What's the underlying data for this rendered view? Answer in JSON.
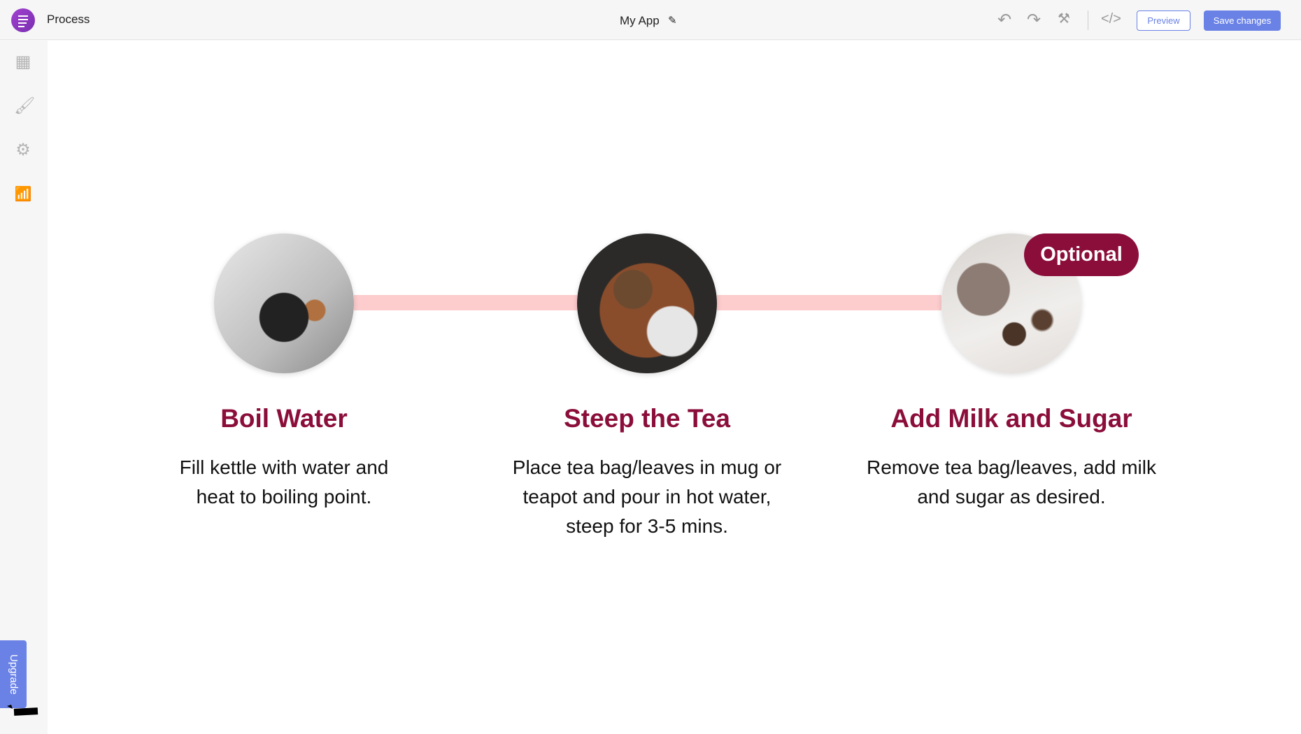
{
  "header": {
    "app_name": "Process",
    "title": "My App",
    "preview_label": "Preview",
    "save_label": "Save changes"
  },
  "sidebar": {
    "items": [
      "table-icon",
      "brush-icon",
      "gear-icon",
      "analytics-icon"
    ],
    "upgrade_label": "Upgrade"
  },
  "colors": {
    "accent": "#6a82e6",
    "title": "#8b0e3a",
    "connector": "#fdcccd",
    "logo": "#9b3fd0"
  },
  "steps": [
    {
      "title": "Boil Water",
      "description": "Fill kettle with water and heat to boiling point.",
      "image": "kettle"
    },
    {
      "title": "Steep the Tea",
      "description": "Place tea bag/leaves in mug or teapot and pour in hot water, steep for 3-5 mins.",
      "image": "teapot-and-cup"
    },
    {
      "title": "Add Milk and Sugar",
      "description": "Remove tea bag/leaves, add milk and sugar as desired.",
      "image": "pouring-tea",
      "badge": "Optional"
    }
  ]
}
